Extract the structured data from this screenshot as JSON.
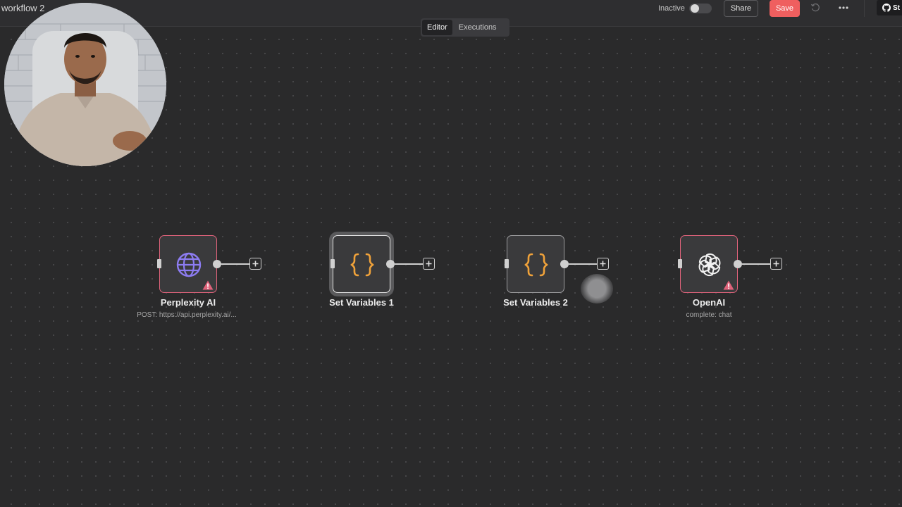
{
  "header": {
    "workflow_title": "workflow 2",
    "active_state_label": "Inactive",
    "share_label": "Share",
    "save_label": "Save",
    "github_label": "St"
  },
  "tabs": [
    {
      "label": "Editor",
      "active": true
    },
    {
      "label": "Executions",
      "active": false
    }
  ],
  "nodes": [
    {
      "name": "Perplexity AI",
      "subtitle": "POST: https://api.perplexity.ai/...",
      "icon": "globe-icon",
      "status": "error"
    },
    {
      "name": "Set Variables 1",
      "subtitle": "",
      "icon": "braces-icon",
      "status": "selected"
    },
    {
      "name": "Set Variables 2",
      "subtitle": "",
      "icon": "braces-icon",
      "status": "normal"
    },
    {
      "name": "OpenAI",
      "subtitle": "complete: chat",
      "icon": "openai-icon",
      "status": "error"
    }
  ],
  "colors": {
    "canvas_bg": "#2a2a2b",
    "save_button": "#ef5f5f",
    "error_border": "#e0637b",
    "braces_icon": "#f0a23a",
    "globe_icon": "#8d7cf2"
  }
}
